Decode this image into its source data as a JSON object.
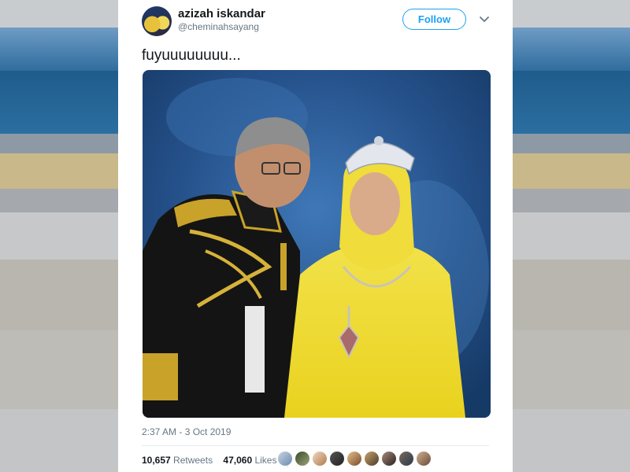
{
  "tweet": {
    "author_name": "azizah iskandar",
    "author_handle": "@cheminahsayang",
    "follow_label": "Follow",
    "text": "fuyuuuuuuuu...",
    "timestamp": "2:37 AM - 3 Oct 2019",
    "retweets_count": "10,657",
    "retweets_label": "Retweets",
    "likes_count": "47,060",
    "likes_label": "Likes"
  },
  "icons": {
    "menu": "chevron-down-icon"
  },
  "colors": {
    "accent": "#1da1f2",
    "text": "#14171a",
    "secondary": "#657786"
  }
}
